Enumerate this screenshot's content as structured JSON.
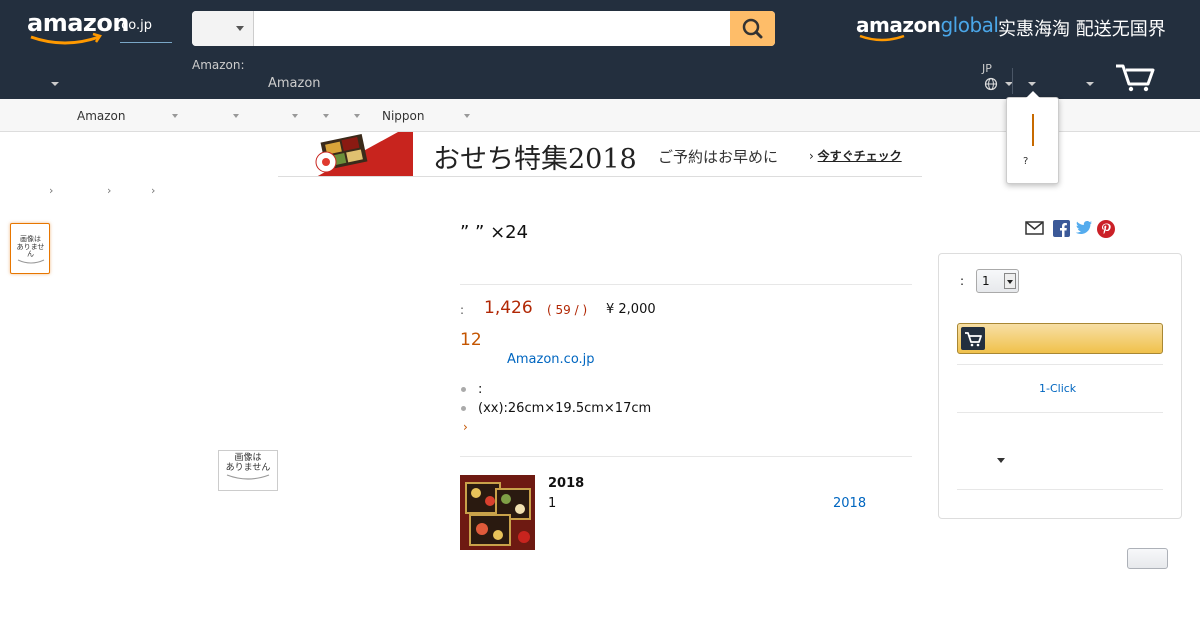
{
  "header": {
    "logo_text": "amazon",
    "logo_tld": ".co.jp",
    "search": {
      "placeholder": ""
    },
    "amazon_global": {
      "part1": "amazon",
      "part2": "global",
      "slogan": "实惠海淘 配送无国界"
    },
    "deliver_label": "Amazon:",
    "deliver_value": "Amazon",
    "lang_code": "JP"
  },
  "subnav": {
    "items": [
      "Amazon",
      "Nippon"
    ]
  },
  "flyout": {
    "text": "?"
  },
  "banner": {
    "title": "おせち特集2018",
    "subtitle": "ご予約はお早めに",
    "cta": "今すぐチェック",
    "cta_arrow": "›"
  },
  "breadcrumb": {
    "separators": [
      "›",
      "›",
      "›"
    ]
  },
  "gallery": {
    "no_image_line1": "画像は",
    "no_image_line2": "ありません"
  },
  "product": {
    "title": "” ” ×24",
    "price_label": ":",
    "price": "1,426",
    "points": "( 59 / )",
    "list_price": "¥ 2,000",
    "stock": "12",
    "seller": "Amazon.co.jp",
    "bullets": [
      ":",
      "(xx):26cm×19.5cm×17cm"
    ],
    "more": "›"
  },
  "promo": {
    "title": "2018",
    "subtitle": "1",
    "link": "2018"
  },
  "buybox": {
    "qty_label": ":",
    "qty_value": "1",
    "one_click": "1-Click"
  },
  "colors": {
    "nav_bg": "#232f3e",
    "search_button": "#febd69",
    "price": "#b12704",
    "link": "#0066c0",
    "stock": "#c45500"
  }
}
